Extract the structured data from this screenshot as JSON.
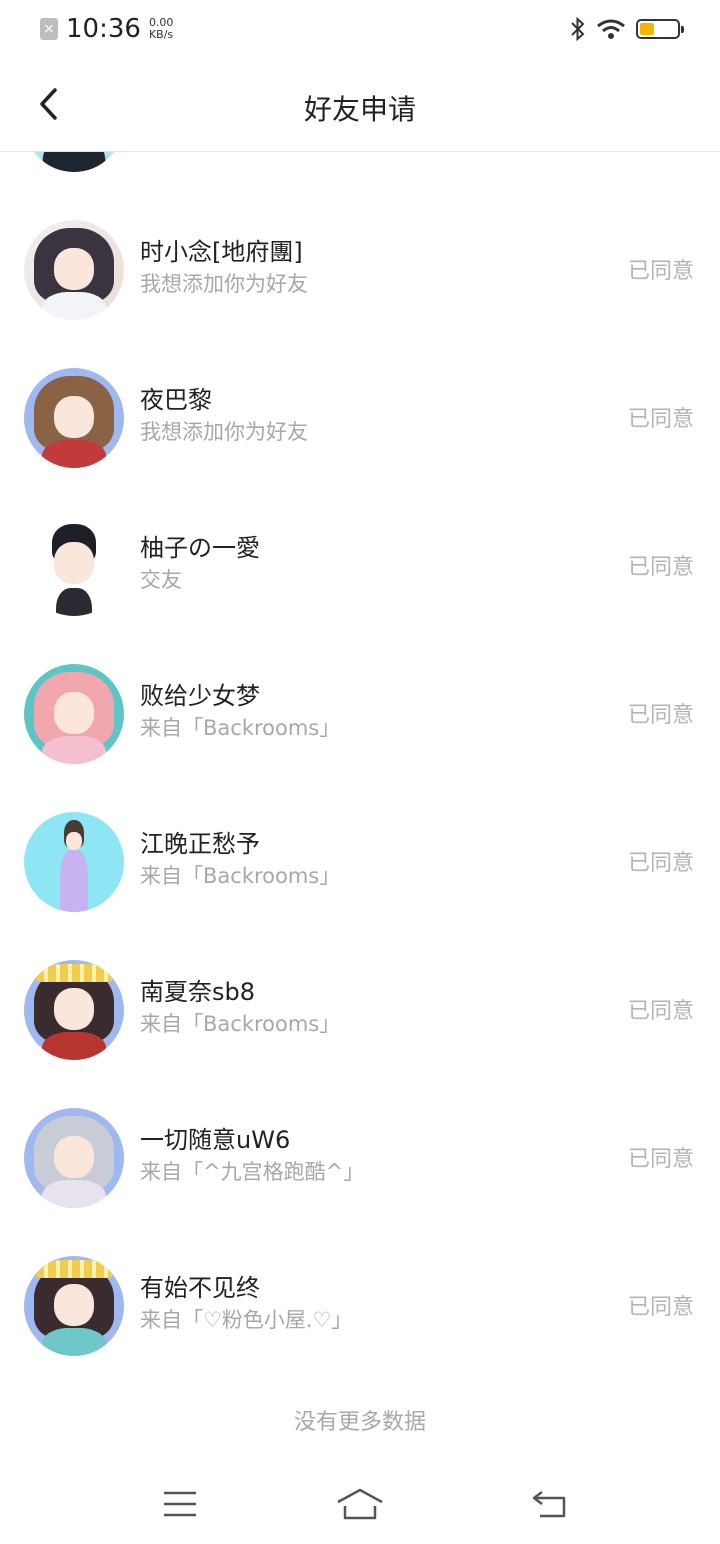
{
  "status_bar": {
    "time": "10:36",
    "speed_value": "0.00",
    "speed_unit": "KB/s",
    "sim_icon": "sim-off-icon",
    "bluetooth_icon": "bluetooth-icon",
    "wifi_icon": "wifi-icon",
    "battery_icon": "battery-icon",
    "battery_color": "#f5b400"
  },
  "header": {
    "title": "好友申请",
    "back_icon": "chevron-left-icon"
  },
  "requests": [
    {
      "name": "时小念[地府團]",
      "message": "我想添加你为好友",
      "status": "已同意"
    },
    {
      "name": "夜巴黎",
      "message": "我想添加你为好友",
      "status": "已同意"
    },
    {
      "name": "柚子の一愛",
      "message": "交友",
      "status": "已同意"
    },
    {
      "name": "败给少女梦",
      "message": "来自「Backrooms」",
      "status": "已同意"
    },
    {
      "name": "江晚正愁予",
      "message": "来自「Backrooms」",
      "status": "已同意"
    },
    {
      "name": "南夏奈sb8",
      "message": "来自「Backrooms」",
      "status": "已同意"
    },
    {
      "name": "一切随意uW6",
      "message": "来自「^九宫格跑酷^」",
      "status": "已同意"
    },
    {
      "name": "有始不见终",
      "message": "来自「♡粉色小屋.♡」",
      "status": "已同意"
    }
  ],
  "footer_text": "没有更多数据",
  "bottom_nav": {
    "menu_icon": "menu-icon",
    "home_icon": "home-icon",
    "back_icon": "return-icon"
  }
}
